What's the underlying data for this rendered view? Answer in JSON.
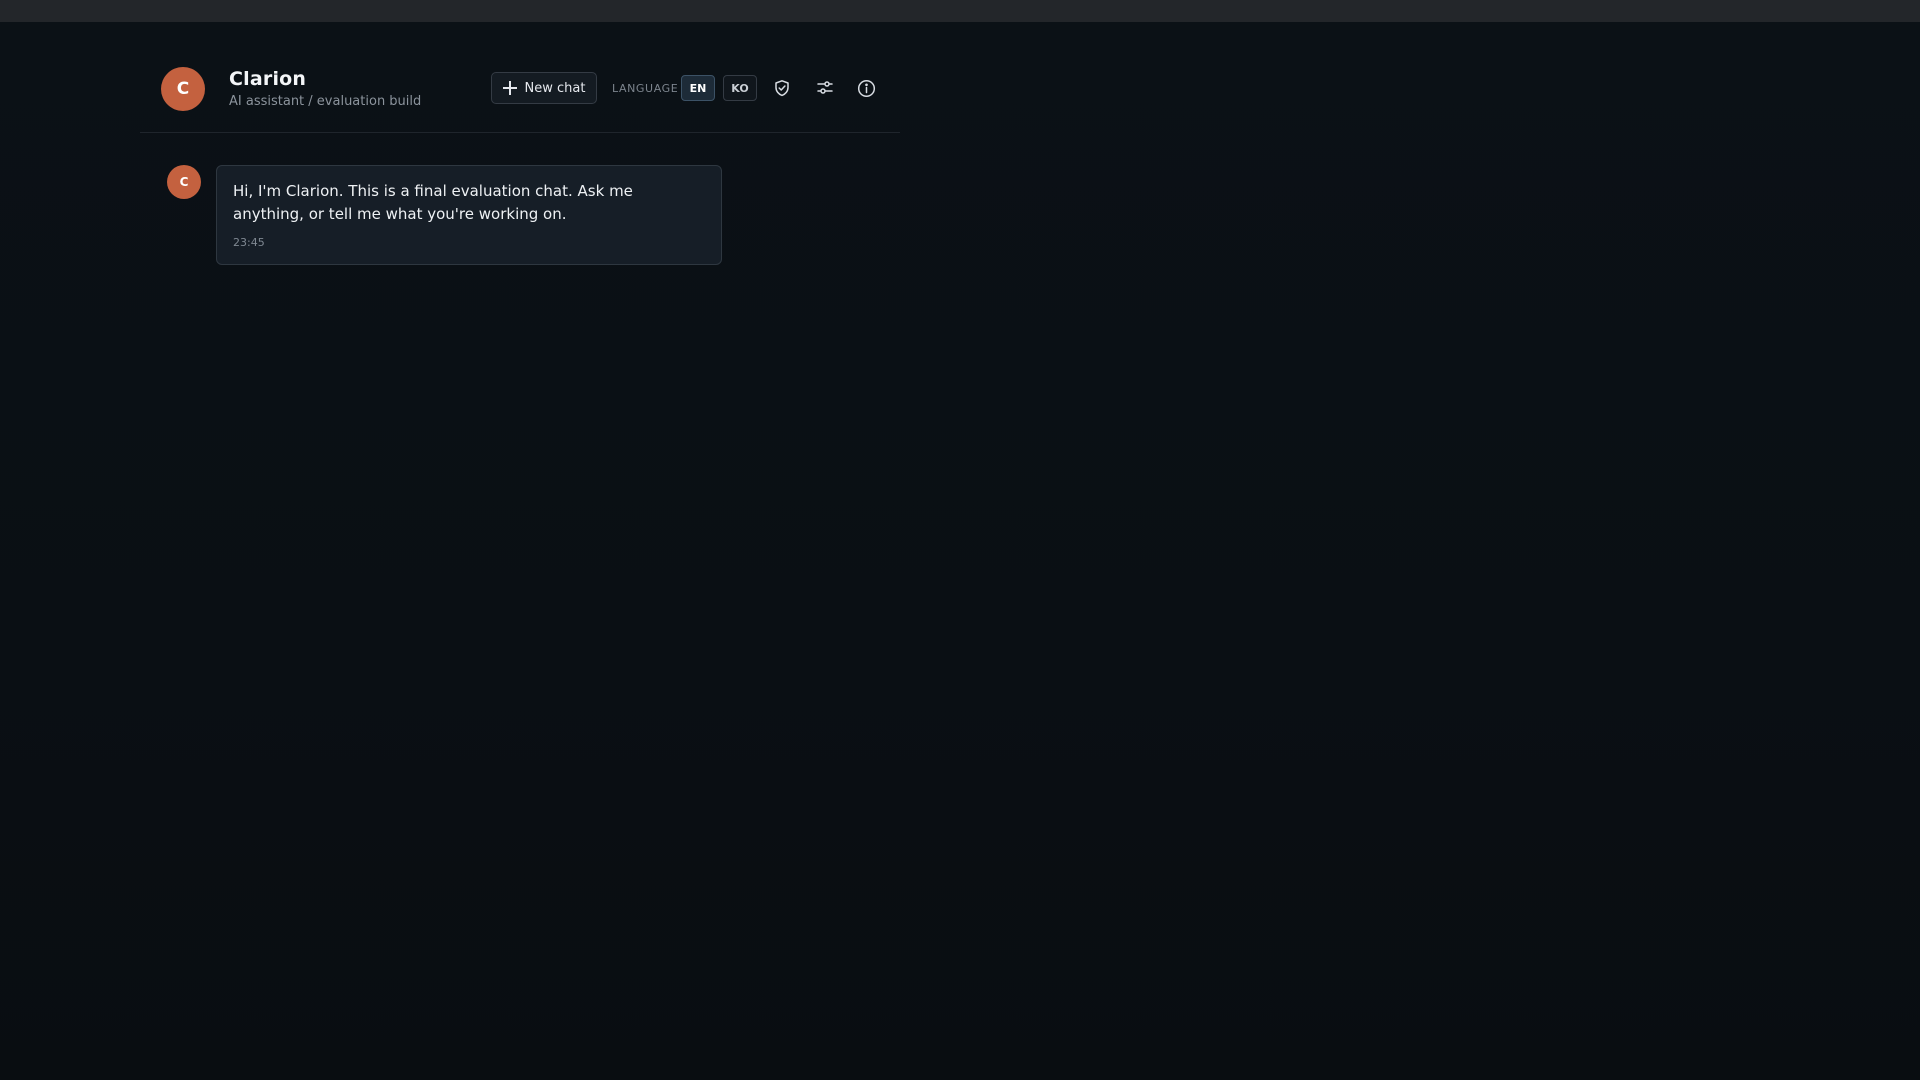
{
  "header": {
    "avatar_initial": "C",
    "title": "Clarion",
    "subtitle": "AI assistant / evaluation build",
    "new_chat_label": "New chat",
    "language_label": "LANGUAGE",
    "languages": [
      "EN",
      "KO"
    ],
    "selected_language": "EN",
    "icons": [
      "shield-check-icon",
      "sliders-icon",
      "info-icon"
    ]
  },
  "messages": [
    {
      "sender_initial": "C",
      "text": "Hi, I'm Clarion. This is a final evaluation chat. Ask me anything, or tell me what you're working on.",
      "time": "23:45"
    }
  ],
  "colors": {
    "background": "#0a0e13",
    "accent_avatar": "#c4613f",
    "bubble": "#161e27",
    "selected_language": "#1d2b38"
  }
}
